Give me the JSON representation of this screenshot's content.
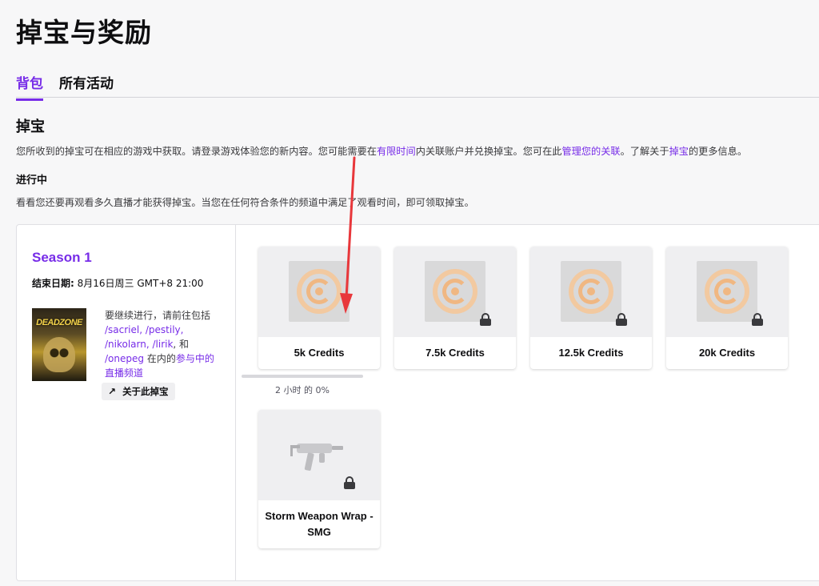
{
  "page": {
    "title": "掉宝与奖励"
  },
  "tabs": [
    {
      "label": "背包",
      "active": true
    },
    {
      "label": "所有活动",
      "active": false
    }
  ],
  "drops": {
    "title": "掉宝",
    "desc_1": "您所收到的掉宝可在相应的游戏中获取。请登录游戏体验您的新内容。您可能需要在",
    "link_limited": "有限时间",
    "desc_2": "内关联账户并兑换掉宝。您可在此",
    "link_manage": "管理您的关联",
    "desc_3": "。了解关于",
    "link_drops": "掉宝",
    "desc_4": "的更多信息。"
  },
  "in_progress": {
    "title": "进行中",
    "desc": "看看您还要再观看多久直播才能获得掉宝。当您在任何符合条件的频道中满足了观看时间，即可领取掉宝。"
  },
  "campaign": {
    "name": "Season 1",
    "end_label": "结束日期:",
    "end_value": " 8月16日周三 GMT+8 21:00",
    "game_logo_text": "DEADZONE",
    "continue_1": "要继续进行，请前往包括 ",
    "channels": "/sacriel, /pestily, /nikolarn, /lirik",
    "continue_2": ", 和 ",
    "channel_last": "/onepeg",
    "continue_3": " 在内的",
    "link_participating": "参与中的直播频道",
    "about_label": "关于此掉宝"
  },
  "rewards": [
    {
      "label": "5k Credits",
      "locked": false
    },
    {
      "label": "7.5k Credits",
      "locked": true
    },
    {
      "label": "12.5k Credits",
      "locked": true
    },
    {
      "label": "20k Credits",
      "locked": true
    },
    {
      "label": "Storm Weapon Wrap - SMG",
      "locked": true
    }
  ],
  "progress": {
    "text": "2 小时 的 0%",
    "fraction": 0.0
  },
  "colors": {
    "accent": "#772ce8",
    "annotation_arrow": "#e8373b"
  }
}
